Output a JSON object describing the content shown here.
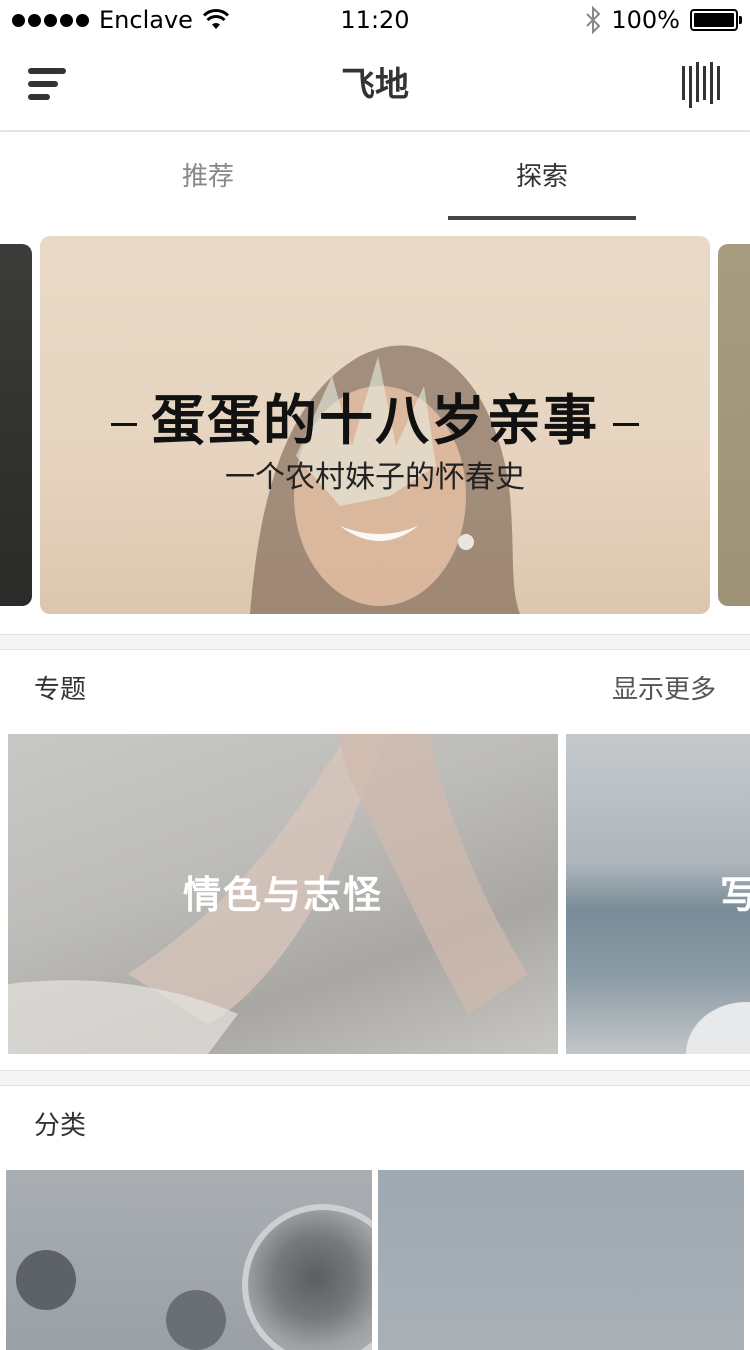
{
  "status_bar": {
    "carrier": "Enclave",
    "time": "11:20",
    "battery": "100%"
  },
  "nav": {
    "title": "飞地",
    "menu_icon": "menu-icon",
    "barcode_icon": "barcode-icon"
  },
  "tabs": [
    {
      "label": "推荐",
      "active": false
    },
    {
      "label": "探索",
      "active": true
    }
  ],
  "banner": {
    "title": "蛋蛋的十八岁亲事",
    "subtitle": "一个农村妹子的怀春史"
  },
  "topics": {
    "title": "专题",
    "more": "显示更多",
    "items": [
      {
        "label": "情色与志怪"
      },
      {
        "label": "写"
      }
    ]
  },
  "categories": {
    "title": "分类"
  },
  "colors": {
    "tab_active": "#333333",
    "tab_inactive": "#888888",
    "underline": "#444444"
  }
}
